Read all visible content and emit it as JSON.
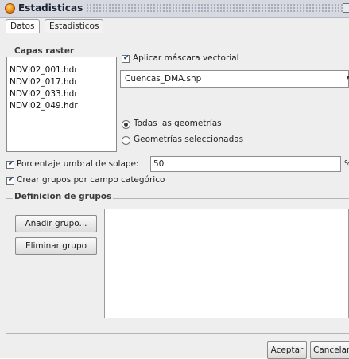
{
  "window": {
    "title": "Estadisticas"
  },
  "tabs": [
    {
      "label": "Datos",
      "active": true
    },
    {
      "label": "Estadisticos",
      "active": false
    }
  ],
  "raster": {
    "legend": "Capas raster",
    "items": [
      "NDVI02_001.hdr",
      "NDVI02_017.hdr",
      "NDVI02_033.hdr",
      "NDVI02_049.hdr"
    ]
  },
  "mask": {
    "label": "Aplicar máscara vectorial",
    "checked": true,
    "layer_value": "Cuencas_DMA.shp"
  },
  "geometry": {
    "all_label": "Todas las geometrías",
    "selected_label": "Geometrías seleccionadas",
    "selected": "all"
  },
  "overlap": {
    "label": "Porcentaje umbral de solape:",
    "value": "50",
    "unit": "%",
    "checked": true
  },
  "category_groups": {
    "label": "Crear grupos por campo categórico",
    "checked": true
  },
  "groups": {
    "legend": "Definicion de grupos",
    "add_label": "Añadir grupo...",
    "remove_label": "Eliminar grupo"
  },
  "footer": {
    "accept_label": "Aceptar",
    "cancel_label": "Cancelar"
  },
  "icons": {
    "app": "gvsig-orb-icon",
    "close": "close-icon",
    "dropdown": "chevron-down-icon"
  },
  "colors": {
    "titlebar": "#d6d9df",
    "window_bg": "#eeeeee",
    "field_bg": "#ffffff"
  }
}
